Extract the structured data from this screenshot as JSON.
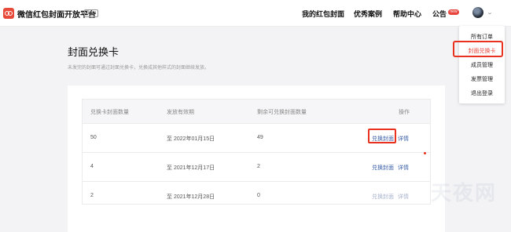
{
  "header": {
    "brand": "微信红包封面开放平台",
    "beta": "Beta",
    "nav": [
      "我的红包封面",
      "优秀案例",
      "帮助中心",
      "公告"
    ],
    "notice_badge": "new"
  },
  "user_menu": {
    "items": [
      "所有订单",
      "封面兑换卡",
      "成员管理",
      "发票管理",
      "退出登录"
    ],
    "active_index": 1
  },
  "page": {
    "title": "封面兑换卡",
    "description": "未发完的封面可通过封面兑换卡，兑换成其他样式的封面继续发放。"
  },
  "table": {
    "columns": [
      "兑换卡封面数量",
      "发放有效期",
      "剩余可兑换封面数量",
      "操作"
    ],
    "rows": [
      {
        "count": "50",
        "expiry": "至 2022年01月15日",
        "remaining": "49",
        "redeem": "兑换封面",
        "detail": "详情"
      },
      {
        "count": "4",
        "expiry": "至 2021年12月17日",
        "remaining": "2",
        "redeem": "兑换封面",
        "detail": "详情"
      },
      {
        "count": "2",
        "expiry": "至 2021年12月28日",
        "remaining": "0",
        "redeem": "兑换封面",
        "detail": "详情"
      }
    ]
  },
  "watermark": "天夜网",
  "colors": {
    "accent_red": "#e8453c",
    "link_blue": "#3a5fa8",
    "link_disabled": "#a9b4cf",
    "highlight": "#e8311f"
  }
}
